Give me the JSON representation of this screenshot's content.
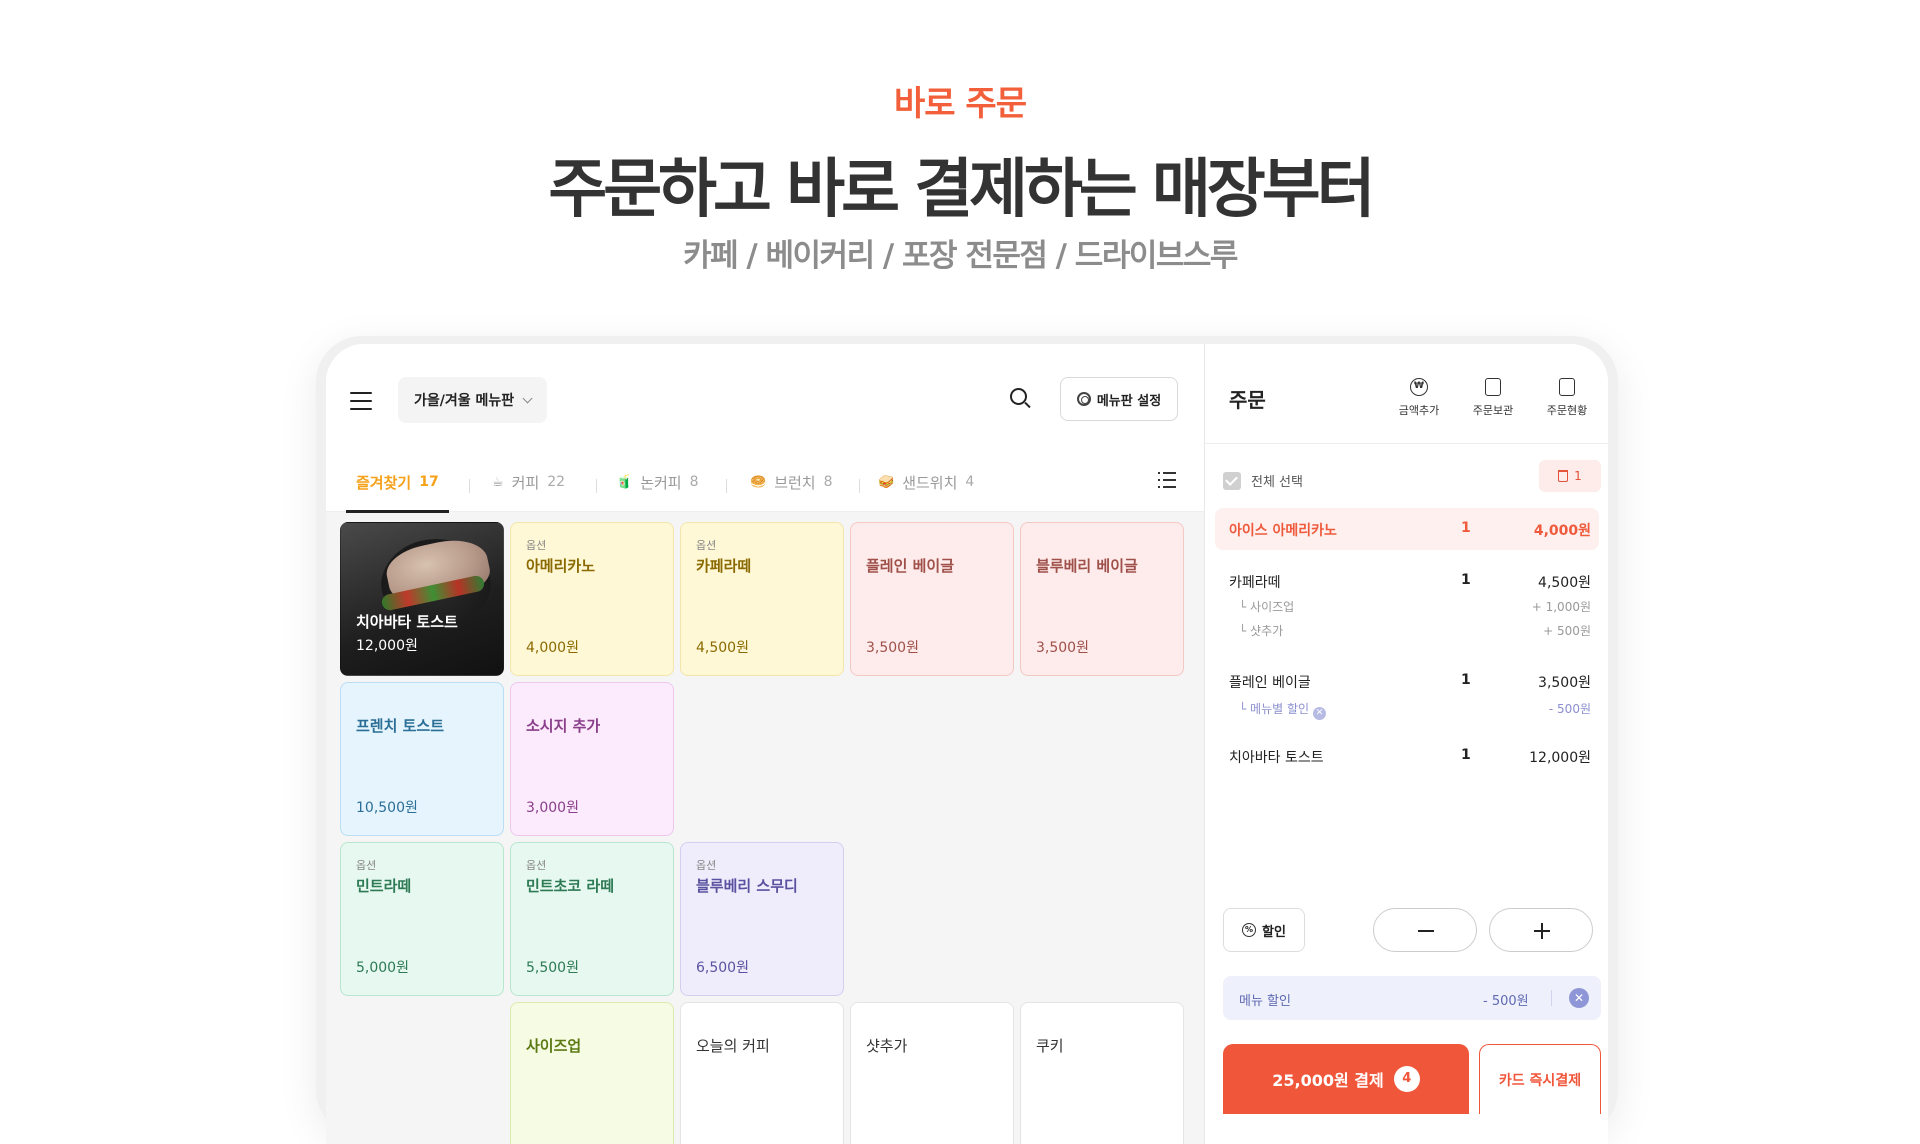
{
  "hero": {
    "eyebrow": "바로 주문",
    "headline": "주문하고 바로 결제하는 매장부터",
    "subline": "카페 / 베이커리 / 포장 전문점 / 드라이브스루"
  },
  "pos": {
    "menuboard": "가을/겨울 메뉴판",
    "settings_label": "메뉴판 설정",
    "tabs": [
      {
        "label": "즐겨찾기",
        "count": "17",
        "icon": ""
      },
      {
        "label": "커피",
        "count": "22",
        "icon": "☕"
      },
      {
        "label": "논커피",
        "count": "8",
        "icon": "🧃"
      },
      {
        "label": "브런치",
        "count": "8",
        "icon": "🥯"
      },
      {
        "label": "샌드위치",
        "count": "4",
        "icon": "🥪"
      }
    ],
    "cards": [
      {
        "opt": "",
        "name": "치아바타 토스트",
        "price": "12,000원"
      },
      {
        "opt": "옵션",
        "name": "아메리카노",
        "price": "4,000원"
      },
      {
        "opt": "옵션",
        "name": "카페라떼",
        "price": "4,500원"
      },
      {
        "opt": "",
        "name": "플레인 베이글",
        "price": "3,500원"
      },
      {
        "opt": "",
        "name": "블루베리 베이글",
        "price": "3,500원"
      },
      {
        "opt": "",
        "name": "프렌치 토스트",
        "price": "10,500원"
      },
      {
        "opt": "",
        "name": "소시지 추가",
        "price": "3,000원"
      },
      {
        "opt": "옵션",
        "name": "민트라떼",
        "price": "5,000원"
      },
      {
        "opt": "옵션",
        "name": "민트초코 라떼",
        "price": "5,500원"
      },
      {
        "opt": "옵션",
        "name": "블루베리 스무디",
        "price": "6,500원"
      },
      {
        "opt": "",
        "name": "사이즈업",
        "price": ""
      },
      {
        "opt": "",
        "name": "오늘의 커피",
        "price": ""
      },
      {
        "opt": "",
        "name": "샷추가",
        "price": ""
      },
      {
        "opt": "",
        "name": "쿠키",
        "price": ""
      }
    ]
  },
  "order": {
    "title": "주문",
    "actions": [
      {
        "label": "금액추가",
        "icon": "add-amount-icon"
      },
      {
        "label": "주문보관",
        "icon": "order-hold-icon"
      },
      {
        "label": "주문현황",
        "icon": "order-status-icon"
      }
    ],
    "select_all": "전체 선택",
    "delete_count": "1",
    "items": [
      {
        "name": "아이스 아메리카노",
        "qty": "1",
        "price": "4,000원"
      },
      {
        "name": "카페라떼",
        "qty": "1",
        "price": "4,500원"
      },
      {
        "name": "플레인 베이글",
        "qty": "1",
        "price": "3,500원"
      },
      {
        "name": "치아바타 토스트",
        "qty": "1",
        "price": "12,000원"
      }
    ],
    "subs": [
      {
        "name": "사이즈업",
        "price": "+ 1,000원"
      },
      {
        "name": "샷추가",
        "price": "+ 500원"
      },
      {
        "name": "메뉴별 할인",
        "price": "- 500원"
      }
    ],
    "discount_btn": "할인",
    "menu_discount": {
      "label": "메뉴 할인",
      "value": "- 500원"
    },
    "pay_label": "25,000원 결제",
    "pay_count": "4",
    "card_pay": "카드 즉시결제"
  },
  "colors": {
    "accent": "#f0563a",
    "favorite": "#f5a21a"
  }
}
